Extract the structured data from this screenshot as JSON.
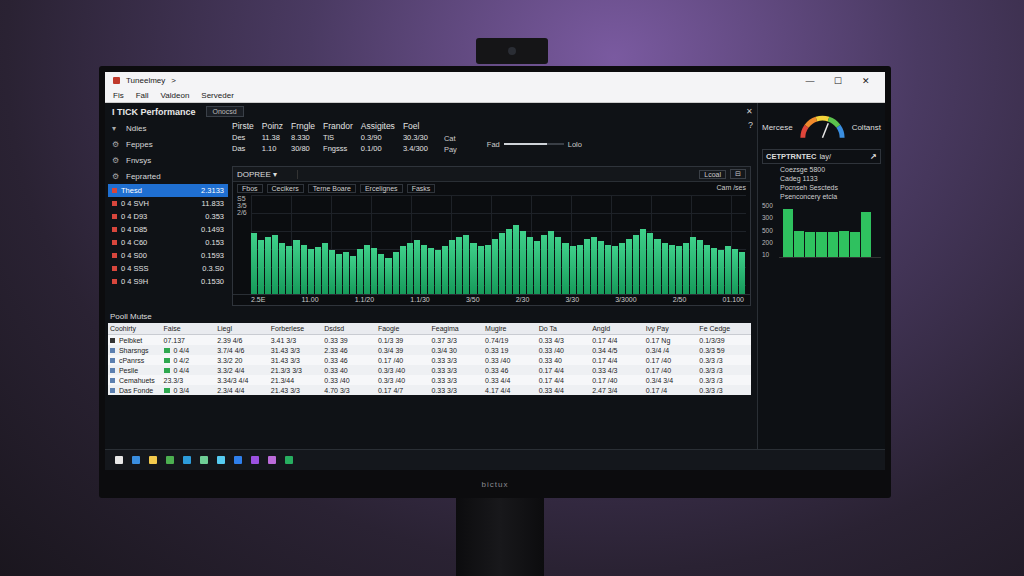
{
  "window": {
    "title": "Tuneelmey",
    "chevron": ">",
    "controls": [
      "—",
      "☐",
      "✕"
    ],
    "close": "✕"
  },
  "menu": [
    "Fis",
    "Fall",
    "Valdeon",
    "Serveder"
  ],
  "app": {
    "title": "I TICK Performance",
    "tab": "Onocsd"
  },
  "sidebar": {
    "nav": [
      {
        "label": "Ndies",
        "icon": "▾"
      },
      {
        "label": "Feppes",
        "icon": "⚙"
      },
      {
        "label": "Fnvsys",
        "icon": "⚙"
      },
      {
        "label": "Feprarted",
        "icon": "⚙"
      }
    ],
    "list": [
      {
        "name": "Thesd",
        "value": "2.3133",
        "selected": true
      },
      {
        "name": "0 4 SVH",
        "value": "11.833",
        "selected": false
      },
      {
        "name": "0 4 D93",
        "value": "0.353",
        "selected": false
      },
      {
        "name": "0 4 D85",
        "value": "0.1493",
        "selected": false
      },
      {
        "name": "0 4 C60",
        "value": "0.153",
        "selected": false
      },
      {
        "name": "0 4 S00",
        "value": "0.1593",
        "selected": false
      },
      {
        "name": "0 4 SSS",
        "value": "0.3.S0",
        "selected": false
      },
      {
        "name": "0 4 S9H",
        "value": "0.1530",
        "selected": false
      }
    ]
  },
  "summary": {
    "columns": [
      "Pirste",
      "Poinz",
      "Frngle",
      "Frandor",
      "Assigites",
      "Foel"
    ],
    "rows": [
      [
        "Des",
        "11.38",
        "8.330",
        "TiS",
        "0.3/90",
        "30.3/30"
      ],
      [
        "Das",
        "1.10",
        "30/80",
        "Fngsss",
        "0.1/00",
        "3.4/300"
      ]
    ],
    "side": {
      "labels": [
        "Cat",
        "Pay"
      ],
      "slider_left": "Fad",
      "slider_right": "Lolo",
      "level": 0.72,
      "help": "?"
    }
  },
  "chart": {
    "title": "DOPREE",
    "dropdown": "▾",
    "button": "Lcoal",
    "button2": "⊟",
    "tabs": [
      "Fbos",
      "Cecikers",
      "Terne Boare",
      "Ercelignes",
      "Fasks"
    ],
    "note": "Cam /ses",
    "y_ticks": [
      "S5",
      "3/5",
      "2/6"
    ],
    "x_ticks": [
      "2.5E",
      "11.00",
      "1.1/20",
      "1.1/30",
      "3/50",
      "2/30",
      "3/30",
      "3/3000",
      "2/50",
      "01.100"
    ],
    "series": [
      {
        "name": "Volume",
        "values": [
          62,
          55,
          58,
          60,
          52,
          48,
          55,
          50,
          45,
          47,
          52,
          44,
          40,
          42,
          38,
          45,
          50,
          46,
          40,
          36,
          42,
          48,
          52,
          55,
          50,
          46,
          44,
          48,
          55,
          58,
          60,
          52,
          48,
          50,
          56,
          62,
          66,
          70,
          64,
          58,
          54,
          60,
          64,
          58,
          52,
          48,
          50,
          56,
          58,
          54,
          50,
          48,
          52,
          56,
          60,
          66,
          62,
          56,
          52,
          50,
          48,
          52,
          58,
          55,
          50,
          46,
          44,
          48,
          45,
          42
        ]
      }
    ]
  },
  "table": {
    "label": "Pooll Mutse",
    "columns": [
      "Coohirty",
      "Faise",
      "Liegl",
      "Forberlese",
      "Dsdsd",
      "Faogie",
      "Feagima",
      "Mugire",
      "Do Ta",
      "Angld",
      "Ivy Pay",
      "Fe Cedge"
    ],
    "rows": [
      {
        "badge": false,
        "expanded": true,
        "cells": [
          "Pelbket",
          "07.137",
          "2.39 4/6",
          "3.41 3/3",
          "0.33 39",
          "0.1/3 39",
          "0.37 3/3",
          "0.74/19",
          "0.33 4/3",
          "0.17 4/4",
          "0.17 Ng",
          "0.1/3/39"
        ]
      },
      {
        "badge": true,
        "expanded": false,
        "cells": [
          "Sharsngs",
          "0 4/4",
          "3.7/4 4/6",
          "31.43 3/3",
          "2.33 46",
          "0.3/4 39",
          "0.3/4 30",
          "0.33 19",
          "0.33 /40",
          "0.34 4/5",
          "0.3/4 /4",
          "0.3/3 59"
        ]
      },
      {
        "badge": true,
        "expanded": false,
        "cells": [
          "cPanrss",
          "0 4/2",
          "3.3/2 20",
          "31.43 3/3",
          "0.33 46",
          "0.17 /40",
          "0.33 3/3",
          "0.33 /40",
          "0.33 40",
          "0.17 4/4",
          "0.17 /40",
          "0.3/3 /3"
        ]
      },
      {
        "badge": true,
        "expanded": false,
        "cells": [
          "Peslle",
          "0 4/4",
          "3.3/2 4/4",
          "21.3/3 3/3",
          "0.33 40",
          "0.3/3 /40",
          "0.33 3/3",
          "0.33 46",
          "0.17 4/4",
          "0.33 4/3",
          "0.17 /40",
          "0.3/3 /3"
        ]
      },
      {
        "badge": false,
        "expanded": false,
        "cells": [
          "Cemahuets",
          "23.3/3",
          "3.34/3 4/4",
          "21.3/44",
          "0.33 /40",
          "0.3/3 /40",
          "0.33 3/3",
          "0.33 4/4",
          "0.17 4/4",
          "0.17 /40",
          "0.3/4 3/4",
          "0.3/3 /3"
        ]
      },
      {
        "badge": true,
        "expanded": false,
        "cells": [
          "Das Fonde",
          "0 3/4",
          "2.3/4 4/4",
          "21.43 3/3",
          "4.70 3/3",
          "0.17 4/7",
          "0.33 3/3",
          "4.17 4/4",
          "0.33 4/4",
          "2.47 3/4",
          "0.17 /4",
          "0.3/3 /3"
        ]
      }
    ]
  },
  "right_panel": {
    "gauge_title": "Mercese",
    "gauge_label": "Coltanst",
    "level": 0.62,
    "section": "CETPTRNTEC",
    "section_tag": "lay/",
    "section_arrow": "↗",
    "lines": [
      "Coezsge 5800",
      "Cadeg 1133",
      "Pocnseh Sescteds"
    ],
    "chart_title": "Psenconcery etcla",
    "y_ticks": [
      "500",
      "300",
      "500",
      "200",
      "10"
    ],
    "values": [
      88,
      48,
      46,
      46,
      46,
      48,
      46,
      82
    ]
  },
  "logo": "bictux"
}
